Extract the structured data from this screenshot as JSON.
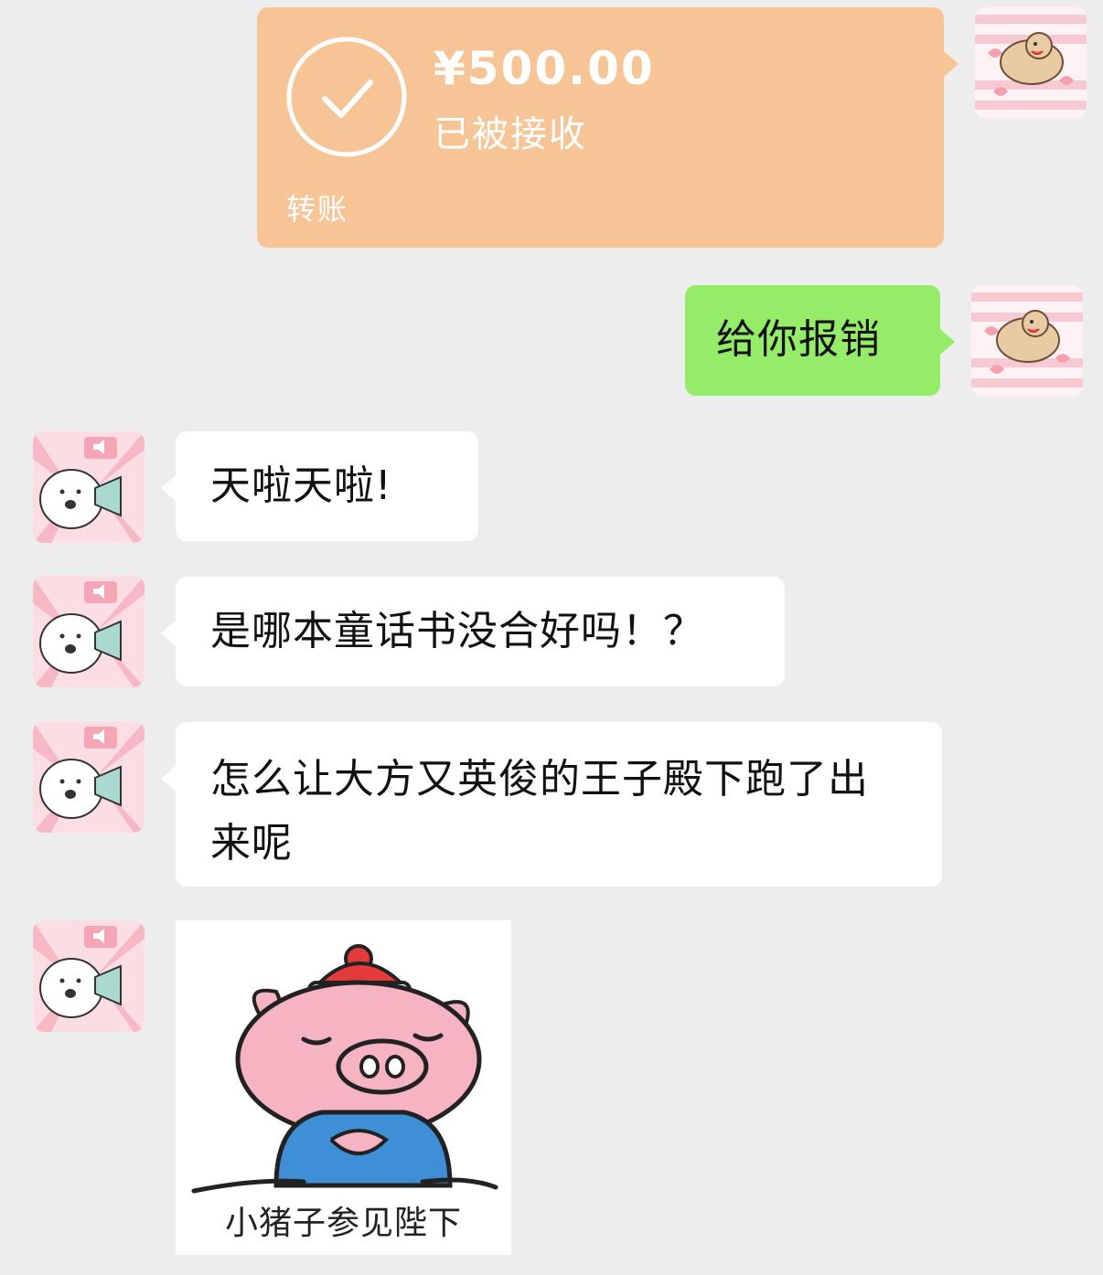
{
  "messages": {
    "transfer": {
      "amount": "¥500.00",
      "status": "已被接收",
      "label": "转账"
    },
    "reimburse": "给你报销",
    "incoming": [
      "天啦天啦!",
      "是哪本童话书没合好吗！？",
      "怎么让大方又英俊的王子殿下跑了出来呢"
    ],
    "sticker_caption": "小猪子参见陛下"
  },
  "colors": {
    "background": "#ededed",
    "outgoing_bubble": "#95ec69",
    "incoming_bubble": "#ffffff",
    "transfer_card": "#f7c595"
  },
  "icons": {
    "avatar_self": "cartoon-dog-avatar",
    "avatar_other": "cartoon-alpaca-megaphone-avatar",
    "transfer_status": "checkmark-circle-icon",
    "sticker": "pig-sticker"
  }
}
